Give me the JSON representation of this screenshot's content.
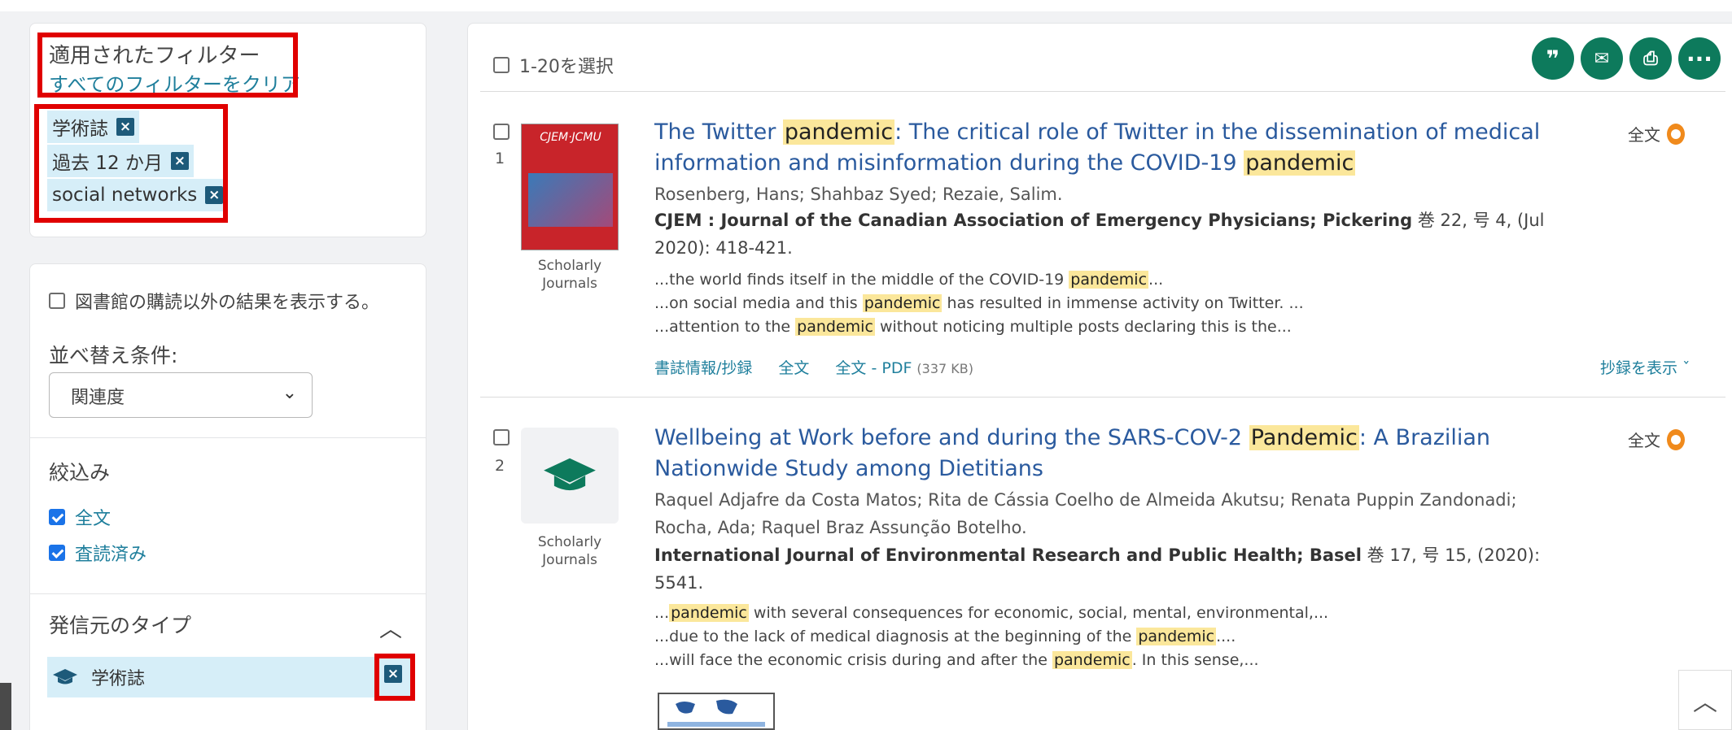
{
  "filters": {
    "applied_title": "適用されたフィルター",
    "clear_all": "すべてのフィルターをクリア",
    "chips": [
      "学術誌",
      "過去 12 か月",
      "social networks"
    ]
  },
  "options": {
    "show_non_subscribed": "図書館の購読以外の結果を表示する。",
    "sort_label": "並べ替え条件:",
    "sort_value": "関連度",
    "refine_label": "絞込み",
    "refine_items": [
      {
        "label": "全文",
        "checked": true
      },
      {
        "label": "査読済み",
        "checked": true
      }
    ],
    "source_type_label": "発信元のタイプ",
    "source_type_selected": "学術誌"
  },
  "results": {
    "select_all": "1-20を選択",
    "actions": [
      "cite",
      "email",
      "print",
      "more"
    ],
    "items": [
      {
        "num": "1",
        "thumb_caption": "Scholarly Journals",
        "cover_text": "CJEM·JCMU",
        "title_a": "The Twitter ",
        "title_hl1": "pandemic",
        "title_b": ": The critical role of Twitter in the dissemination of medical information and misinformation during the COVID-19 ",
        "title_hl2": "pandemic",
        "authors": "Rosenberg, Hans; Shahbaz Syed; Rezaie, Salim.",
        "pub_bold": "CJEM : Journal of the Canadian Association of Emergency Physicians; Pickering",
        "pub_rest": " 巻 22, 号 4,  (Jul 2020): 418-421.",
        "snippets": [
          {
            "pre": "...the world finds itself in the middle of the COVID-19 ",
            "hl": "pandemic",
            "post": "..."
          },
          {
            "pre": "...on social media and this ",
            "hl": "pandemic",
            "post": " has resulted in immense activity on Twitter. ..."
          },
          {
            "pre": "...attention to the ",
            "hl": "pandemic",
            "post": " without noticing multiple posts declaring this is the..."
          }
        ],
        "links": {
          "abstract": "書誌情報/抄録",
          "fulltext": "全文",
          "pdf": "全文 - PDF",
          "pdf_size": "(337 KB)"
        },
        "show_abstract": "抄録を表示 ˇ",
        "fulltext_badge": "全文"
      },
      {
        "num": "2",
        "thumb_caption": "Scholarly Journals",
        "title_a": "Wellbeing at Work before and during the SARS-COV-2 ",
        "title_hl1": "Pandemic",
        "title_b": ": A Brazilian Nationwide Study among Dietitians",
        "authors_1": "Raquel Adjafre da Costa Matos; Rita de Cássia Coelho de Almeida Akutsu; Renata Puppin Zandonadi;",
        "authors_2": "Rocha, Ada; Raquel Braz Assunção Botelho.",
        "pub_bold": "International Journal of Environmental Research and Public Health; Basel",
        "pub_rest": " 巻 17, 号 15,  (2020): 5541.",
        "snippets": [
          {
            "pre": "...",
            "hl": "pandemic",
            "post": " with several consequences for economic, social, mental, environmental,..."
          },
          {
            "pre": "...due to the lack of medical diagnosis at the beginning of the ",
            "hl": "pandemic",
            "post": "...."
          },
          {
            "pre": "...will face the economic crisis during and after the ",
            "hl": "pandemic",
            "post": ". In this sense,..."
          }
        ],
        "fulltext_badge": "全文"
      }
    ]
  }
}
